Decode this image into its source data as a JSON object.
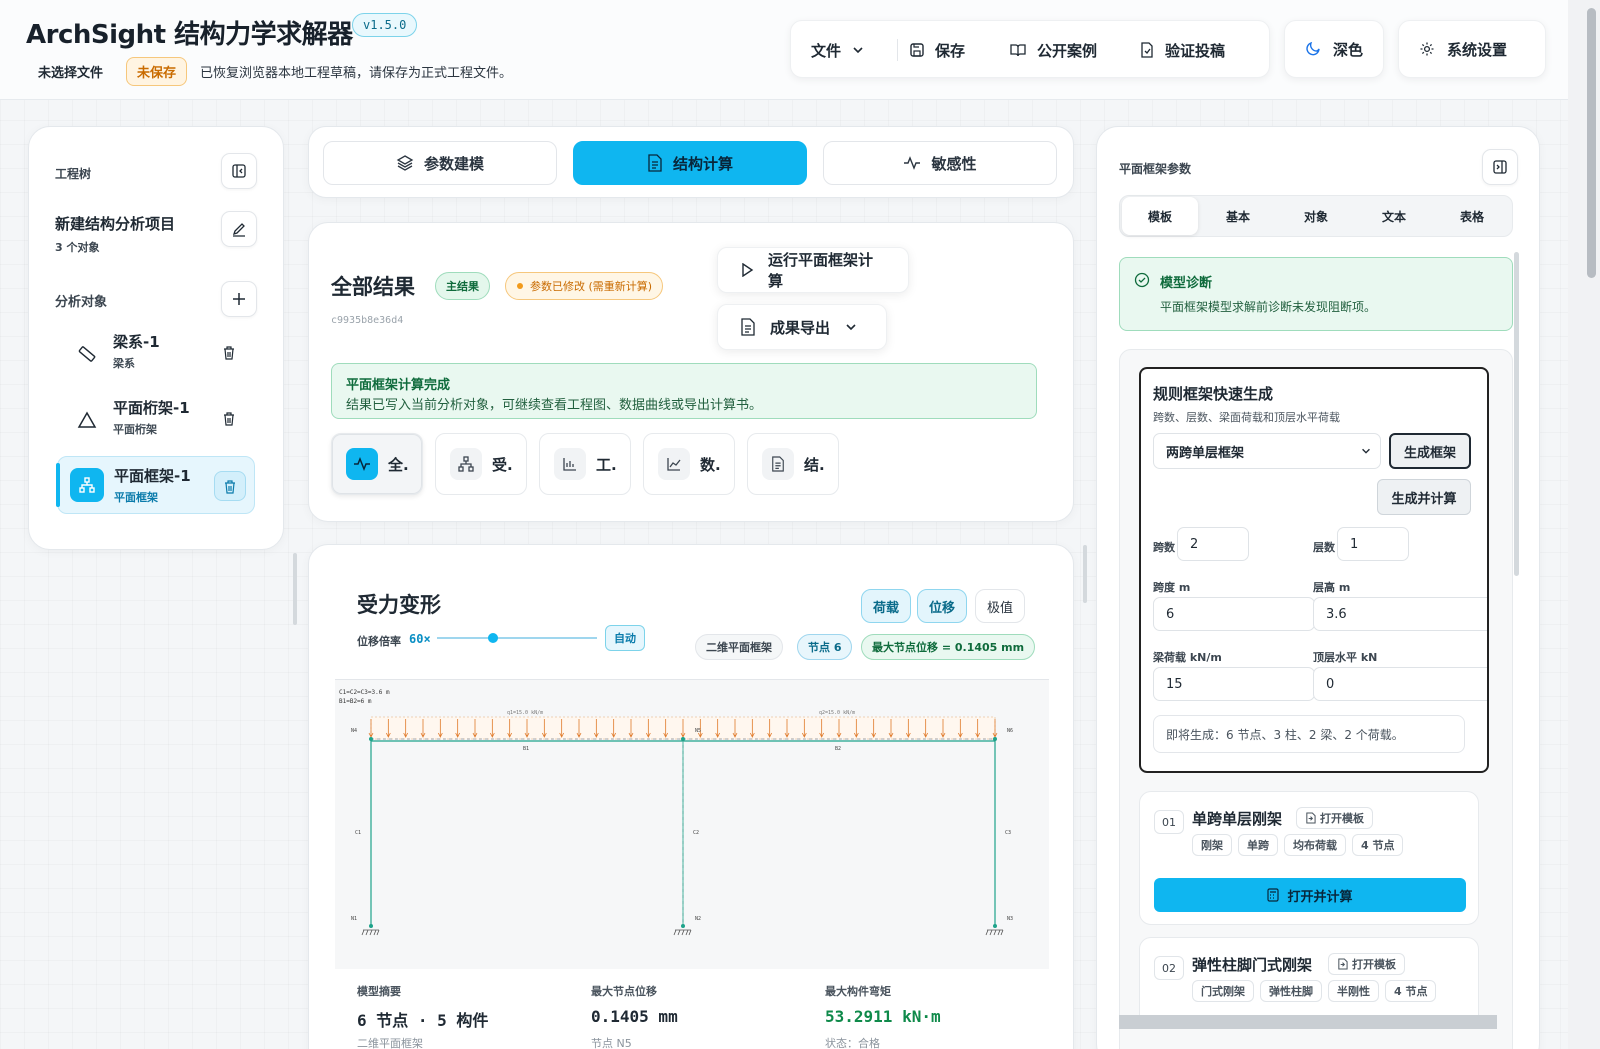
{
  "header": {
    "app_title": "ArchSight 结构力学求解器",
    "version": "v1.5.0",
    "file_status": "未选择文件",
    "unsaved_badge": "未保存",
    "restore_message": "已恢复浏览器本地工程草稿，请保存为正式工程文件。",
    "toolbar": {
      "file": "文件",
      "save": "保存",
      "public_cases": "公开案例",
      "verify_submit": "验证投稿",
      "dark_mode": "深色",
      "settings": "系统设置"
    }
  },
  "left_panel": {
    "tree_label": "工程树",
    "project_name": "新建结构分析项目",
    "project_count": "3 个对象",
    "objects_label": "分析对象",
    "objects": [
      {
        "name": "梁系-1",
        "type": "梁系",
        "icon": "ruler-icon",
        "selected": false
      },
      {
        "name": "平面桁架-1",
        "type": "平面桁架",
        "icon": "triangle-icon",
        "selected": false
      },
      {
        "name": "平面框架-1",
        "type": "平面框架",
        "icon": "network-icon",
        "selected": true
      }
    ]
  },
  "main_tabs": [
    {
      "label": "参数建模",
      "icon": "layers-icon",
      "active": false
    },
    {
      "label": "结构计算",
      "icon": "document-icon",
      "active": true
    },
    {
      "label": "敏感性",
      "icon": "pulse-icon",
      "active": false
    }
  ],
  "results": {
    "title": "全部结果",
    "main_badge": "主结果",
    "modified_badge": "参数已修改 (需重新计算)",
    "hash": "c9935b8e36d4",
    "run_button": "运行平面框架计算",
    "export_button": "成果导出",
    "notice_title": "平面框架计算完成",
    "notice_desc": "结果已写入当前分析对象，可继续查看工程图、数据曲线或导出计算书。",
    "sub_tabs": [
      {
        "label": "全.",
        "icon": "pulse-icon",
        "active": true
      },
      {
        "label": "受.",
        "icon": "network-icon",
        "active": false
      },
      {
        "label": "工.",
        "icon": "bar-chart-icon",
        "active": false
      },
      {
        "label": "数.",
        "icon": "line-chart-icon",
        "active": false
      },
      {
        "label": "结.",
        "icon": "document-icon",
        "active": false
      }
    ]
  },
  "deformation": {
    "title": "受力变形",
    "scale_label": "位移倍率",
    "scale_value": "60×",
    "scale_fraction": 0.35,
    "auto_button": "自动",
    "toggles": {
      "load": "荷载",
      "displacement": "位移",
      "extreme": "极值"
    },
    "chips": {
      "model_type": "二维平面框架",
      "nodes": "节点 6",
      "max_disp": "最大节点位移 = 0.1405 mm"
    },
    "diagram": {
      "note1": "C1=C2=C3=3.6 m",
      "note2": "B1=B2=6 m",
      "load1": "q1=15.0 kN/m",
      "load2": "q2=15.0 kN/m",
      "labels": {
        "N1": "N1",
        "N2": "N2",
        "N3": "N3",
        "N4": "N4",
        "N5": "N5",
        "N6": "N6",
        "B1": "B1",
        "B2": "B2",
        "C1": "C1",
        "C2": "C2",
        "C3": "C3"
      }
    },
    "stats": [
      {
        "label": "模型摘要",
        "value": "6 节点 · 5 构件",
        "sub": "二维平面框架"
      },
      {
        "label": "最大节点位移",
        "value": "0.1405 mm",
        "sub": "节点 N5"
      },
      {
        "label": "最大构件弯矩",
        "value": "53.2911 kN·m",
        "sub": "状态：合格"
      }
    ]
  },
  "right_panel": {
    "title": "平面框架参数",
    "tabs": [
      "模板",
      "基本",
      "对象",
      "文本",
      "表格"
    ],
    "diagnosis_title": "模型诊断",
    "diagnosis_desc": "平面框架模型求解前诊断未发现阻断项。",
    "quick_title": "规则框架快速生成",
    "quick_desc": "跨数、层数、梁面荷载和顶层水平荷载",
    "preset_select": "两跨单层框架",
    "generate_button": "生成框架",
    "generate_calc_button": "生成并计算",
    "fields": {
      "spans_label": "跨数",
      "spans": "2",
      "floors_label": "层数",
      "floors": "1",
      "span_len_label": "跨度 m",
      "span_len": "6",
      "floor_h_label": "层高 m",
      "floor_h": "3.6",
      "beam_load_label": "梁荷载 kN/m",
      "beam_load": "15",
      "top_h_label": "顶层水平 kN",
      "top_h": "0"
    },
    "preview": "即将生成：6 节点、3 柱、2 梁、2 个荷载。",
    "templates": [
      {
        "num": "01",
        "name": "单跨单层刚架",
        "open": "打开模板",
        "tags": [
          "刚架",
          "单跨",
          "均布荷载",
          "4 节点"
        ],
        "action": "打开并计算"
      },
      {
        "num": "02",
        "name": "弹性柱脚门式刚架",
        "open": "打开模板",
        "tags": [
          "门式刚架",
          "弹性柱脚",
          "半刚性",
          "4 节点"
        ]
      }
    ]
  }
}
